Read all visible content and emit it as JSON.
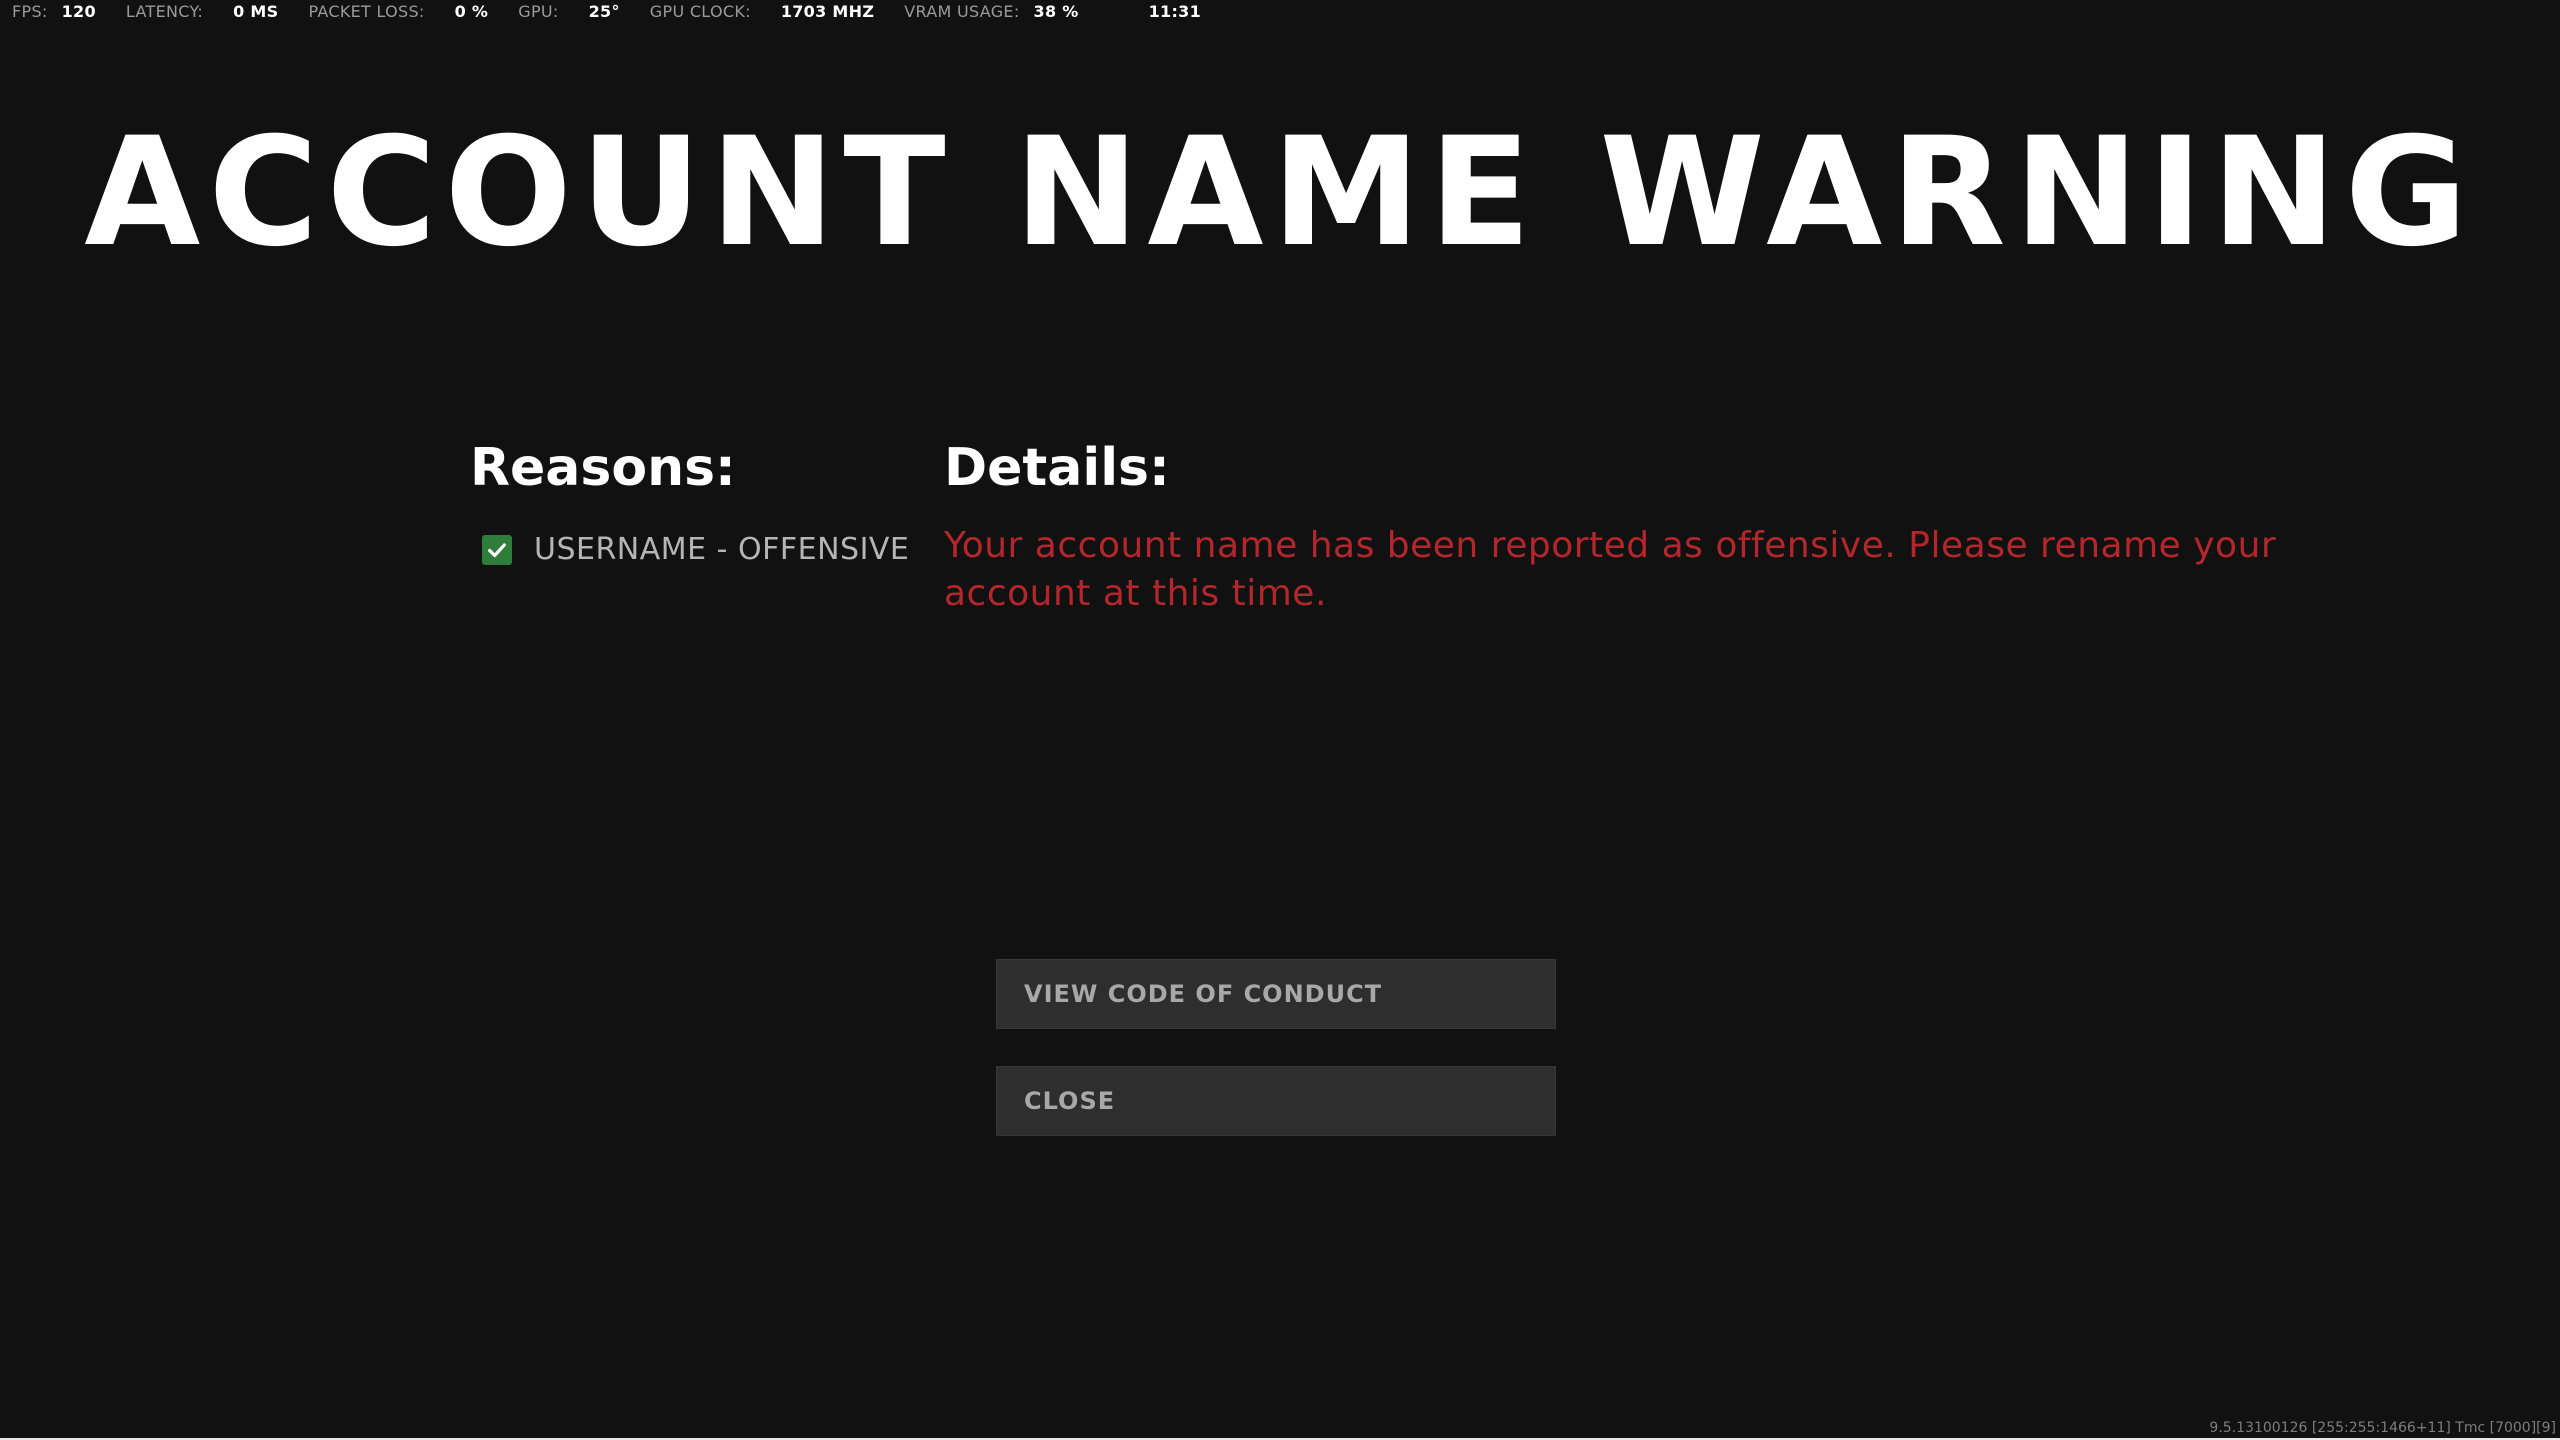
{
  "hud": {
    "fps": {
      "label": "FPS:",
      "value": "120"
    },
    "latency": {
      "label": "LATENCY:",
      "value": "0 MS"
    },
    "packet_loss": {
      "label": "PACKET LOSS:",
      "value": "0 %"
    },
    "gpu": {
      "label": "GPU:",
      "value": "25°"
    },
    "gpu_clock": {
      "label": "GPU CLOCK:",
      "value": "1703 MHZ"
    },
    "vram": {
      "label": "VRAM USAGE:",
      "value": "38 %"
    },
    "clock": "11:31"
  },
  "title": "ACCOUNT NAME WARNING",
  "reasons": {
    "heading": "Reasons:",
    "items": [
      {
        "label": "USERNAME - OFFENSIVE",
        "checked": true
      }
    ]
  },
  "details": {
    "heading": "Details:",
    "text": "Your account name has been reported as offensive. Please rename your account at this time."
  },
  "buttons": {
    "view_conduct": "VIEW CODE OF CONDUCT",
    "close": "CLOSE"
  },
  "build_info": "9.5.13100126 [255:255:1466+11] Tmc [7000][9]",
  "colors": {
    "background": "#111111",
    "details_text": "#b3262b",
    "checkbox": "#2f7d3a",
    "button_bg": "#2e2e2e"
  },
  "icons": {
    "checkbox": "check-icon"
  }
}
